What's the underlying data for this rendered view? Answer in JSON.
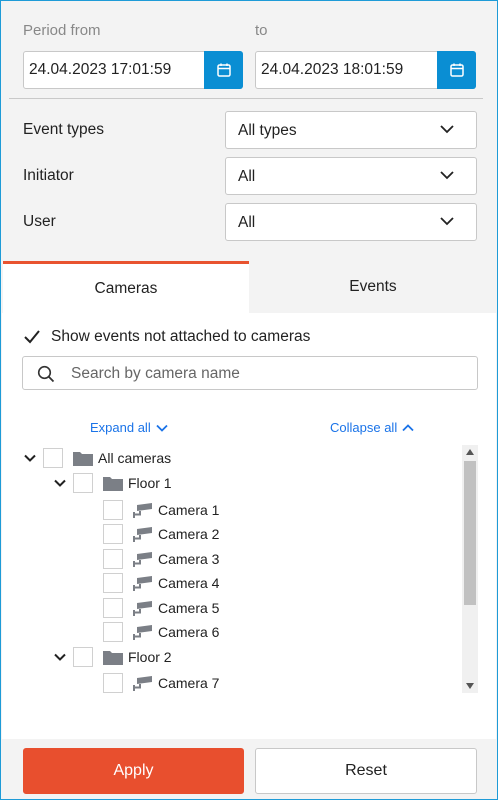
{
  "period": {
    "from_label": "Period from",
    "to_label": "to",
    "from_value": "24.04.2023 17:01:59",
    "to_value": "24.04.2023 18:01:59"
  },
  "filters": [
    {
      "label": "Event types",
      "value": "All types"
    },
    {
      "label": "Initiator",
      "value": "All"
    },
    {
      "label": "User",
      "value": "All"
    }
  ],
  "tabs": [
    {
      "label": "Cameras",
      "active": true
    },
    {
      "label": "Events",
      "active": false
    }
  ],
  "cameras_tab": {
    "show_unattached_label": "Show events not attached to cameras",
    "show_unattached_checked": true,
    "search_placeholder": "Search by camera name",
    "expand_all": "Expand all",
    "collapse_all": "Collapse all",
    "tree": {
      "root": "All cameras",
      "floors": [
        {
          "name": "Floor 1",
          "cameras": [
            "Camera 1",
            "Camera 2",
            "Camera 3",
            "Camera 4",
            "Camera 5",
            "Camera 6"
          ]
        },
        {
          "name": "Floor 2",
          "cameras": [
            "Camera 7"
          ]
        }
      ]
    }
  },
  "footer": {
    "apply": "Apply",
    "reset": "Reset"
  },
  "colors": {
    "accent_blue": "#0a8ed3",
    "apply_red": "#e84f2e",
    "link_blue": "#1a73e8",
    "tab_active_border": "#e8532f"
  }
}
